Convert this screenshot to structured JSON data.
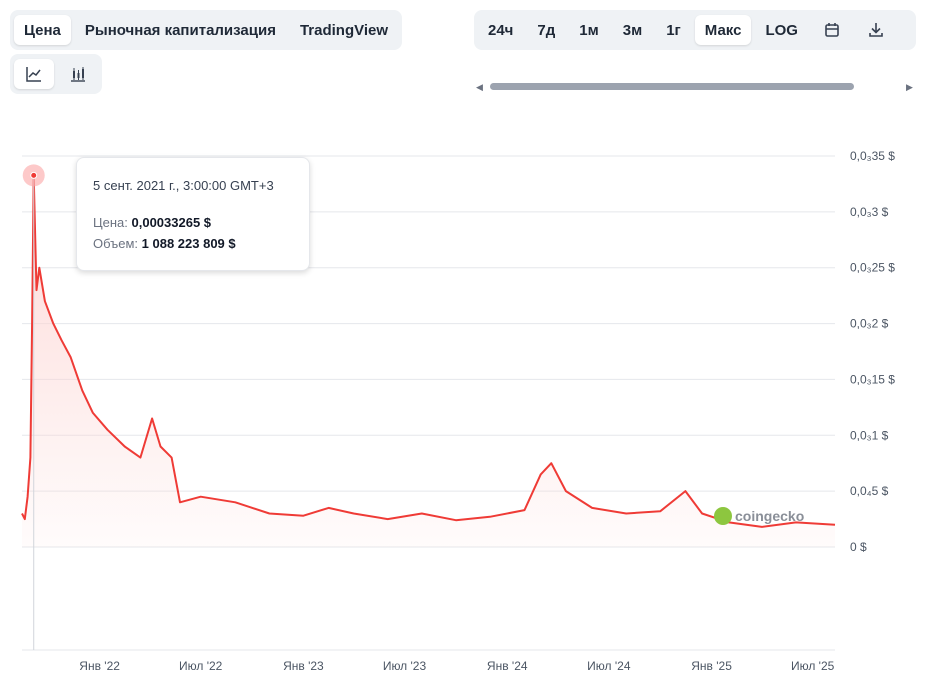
{
  "tabs_main": [
    {
      "label": "Цена",
      "active": true
    },
    {
      "label": "Рыночная капитализация",
      "active": false
    },
    {
      "label": "TradingView",
      "active": false
    }
  ],
  "tabs_range": [
    {
      "label": "24ч",
      "active": false
    },
    {
      "label": "7д",
      "active": false
    },
    {
      "label": "1м",
      "active": false
    },
    {
      "label": "3м",
      "active": false
    },
    {
      "label": "1г",
      "active": false
    },
    {
      "label": "Макс",
      "active": true
    },
    {
      "label": "LOG",
      "active": false
    }
  ],
  "range_icons": [
    "calendar-icon",
    "download-icon"
  ],
  "view_buttons": [
    {
      "icon": "line-chart-icon",
      "active": true
    },
    {
      "icon": "candlestick-icon",
      "active": false
    }
  ],
  "tooltip": {
    "date": "5 сент. 2021 г., 3:00:00 GMT+3",
    "price_label": "Цена:",
    "price_value": "0,00033265 $",
    "volume_label": "Объем:",
    "volume_value": "1 088 223 809 $"
  },
  "watermark": "coingecko",
  "colors": {
    "line": "#ef3b36",
    "area_top": "#fdd5d3",
    "grid": "#e5e7eb",
    "active_bg": "#ffffff",
    "segment_bg": "#eff2f5"
  },
  "chart_data": {
    "type": "area",
    "title": "",
    "xlabel": "",
    "ylabel": "",
    "x_tick_labels": [
      "Янв '22",
      "Июл '22",
      "Янв '23",
      "Июл '23",
      "Янв '24",
      "Июл '24",
      "Янв '25",
      "Июл '25"
    ],
    "y_tick_labels": [
      "0 $",
      "0,0₄5 $",
      "0,0₃1 $",
      "0,0₃15 $",
      "0,0₃2 $",
      "0,0₃25 $",
      "0,0₃3 $",
      "0,0₃35 $"
    ],
    "y_ticks": [
      0,
      5e-05,
      0.0001,
      0.00015,
      0.0002,
      0.00025,
      0.0003,
      0.00035
    ],
    "ylim": [
      0,
      0.00035
    ],
    "x_range": [
      "2021-08-15",
      "2025-08-10"
    ],
    "grid": true,
    "highlight": {
      "x": "2021-09-05",
      "y": 0.00033265
    },
    "series": [
      {
        "values": [
          [
            "2021-08-15",
            3e-05
          ],
          [
            "2021-08-20",
            2.5e-05
          ],
          [
            "2021-08-25",
            4.5e-05
          ],
          [
            "2021-08-30",
            8e-05
          ],
          [
            "2021-09-02",
            0.0002
          ],
          [
            "2021-09-05",
            0.00033265
          ],
          [
            "2021-09-10",
            0.00023
          ],
          [
            "2021-09-15",
            0.00025
          ],
          [
            "2021-09-25",
            0.00022
          ],
          [
            "2021-10-10",
            0.0002
          ],
          [
            "2021-10-25",
            0.000185
          ],
          [
            "2021-11-10",
            0.00017
          ],
          [
            "2021-12-01",
            0.00014
          ],
          [
            "2021-12-20",
            0.00012
          ],
          [
            "2022-01-15",
            0.000105
          ],
          [
            "2022-02-15",
            9e-05
          ],
          [
            "2022-03-15",
            8e-05
          ],
          [
            "2022-04-05",
            0.000115
          ],
          [
            "2022-04-20",
            9e-05
          ],
          [
            "2022-05-10",
            8e-05
          ],
          [
            "2022-05-25",
            4e-05
          ],
          [
            "2022-07-01",
            4.5e-05
          ],
          [
            "2022-09-01",
            4e-05
          ],
          [
            "2022-11-01",
            3e-05
          ],
          [
            "2023-01-01",
            2.8e-05
          ],
          [
            "2023-02-15",
            3.5e-05
          ],
          [
            "2023-04-01",
            3e-05
          ],
          [
            "2023-06-01",
            2.5e-05
          ],
          [
            "2023-08-01",
            3e-05
          ],
          [
            "2023-10-01",
            2.4e-05
          ],
          [
            "2023-12-01",
            2.7e-05
          ],
          [
            "2024-02-01",
            3.3e-05
          ],
          [
            "2024-03-01",
            6.5e-05
          ],
          [
            "2024-03-20",
            7.5e-05
          ],
          [
            "2024-04-15",
            5e-05
          ],
          [
            "2024-06-01",
            3.5e-05
          ],
          [
            "2024-08-01",
            3e-05
          ],
          [
            "2024-10-01",
            3.2e-05
          ],
          [
            "2024-11-15",
            5e-05
          ],
          [
            "2024-12-15",
            3e-05
          ],
          [
            "2025-02-01",
            2.2e-05
          ],
          [
            "2025-04-01",
            1.8e-05
          ],
          [
            "2025-06-01",
            2.2e-05
          ],
          [
            "2025-08-10",
            2e-05
          ]
        ]
      }
    ]
  }
}
